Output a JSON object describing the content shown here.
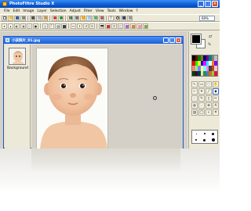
{
  "app": {
    "title": "PhotoFiltre Studio X"
  },
  "window_controls": {
    "minimize": "_",
    "maximize": "□",
    "close": "✕"
  },
  "menu": {
    "items": [
      "File",
      "Edit",
      "Image",
      "Layer",
      "Selection",
      "Adjust",
      "Filter",
      "View",
      "Tools",
      "Window",
      "?"
    ]
  },
  "toolbar": {
    "zoom_value": "69%"
  },
  "document": {
    "title": "小孩照片_01.jpg",
    "layer_label": "Background"
  },
  "palette": {
    "opacity_label": "%",
    "colors": {
      "foreground": "#000000",
      "background": "#ffffff",
      "title_gradient_start": "#3a8cf0",
      "title_gradient_end": "#0848b8"
    }
  },
  "icons": [
    "new-icon",
    "open-icon",
    "save-icon",
    "print-icon",
    "undo-icon",
    "redo-icon",
    "text-icon",
    "zoom-icon",
    "brush-icon",
    "eraser-icon",
    "magic-wand-icon",
    "crop-icon"
  ]
}
